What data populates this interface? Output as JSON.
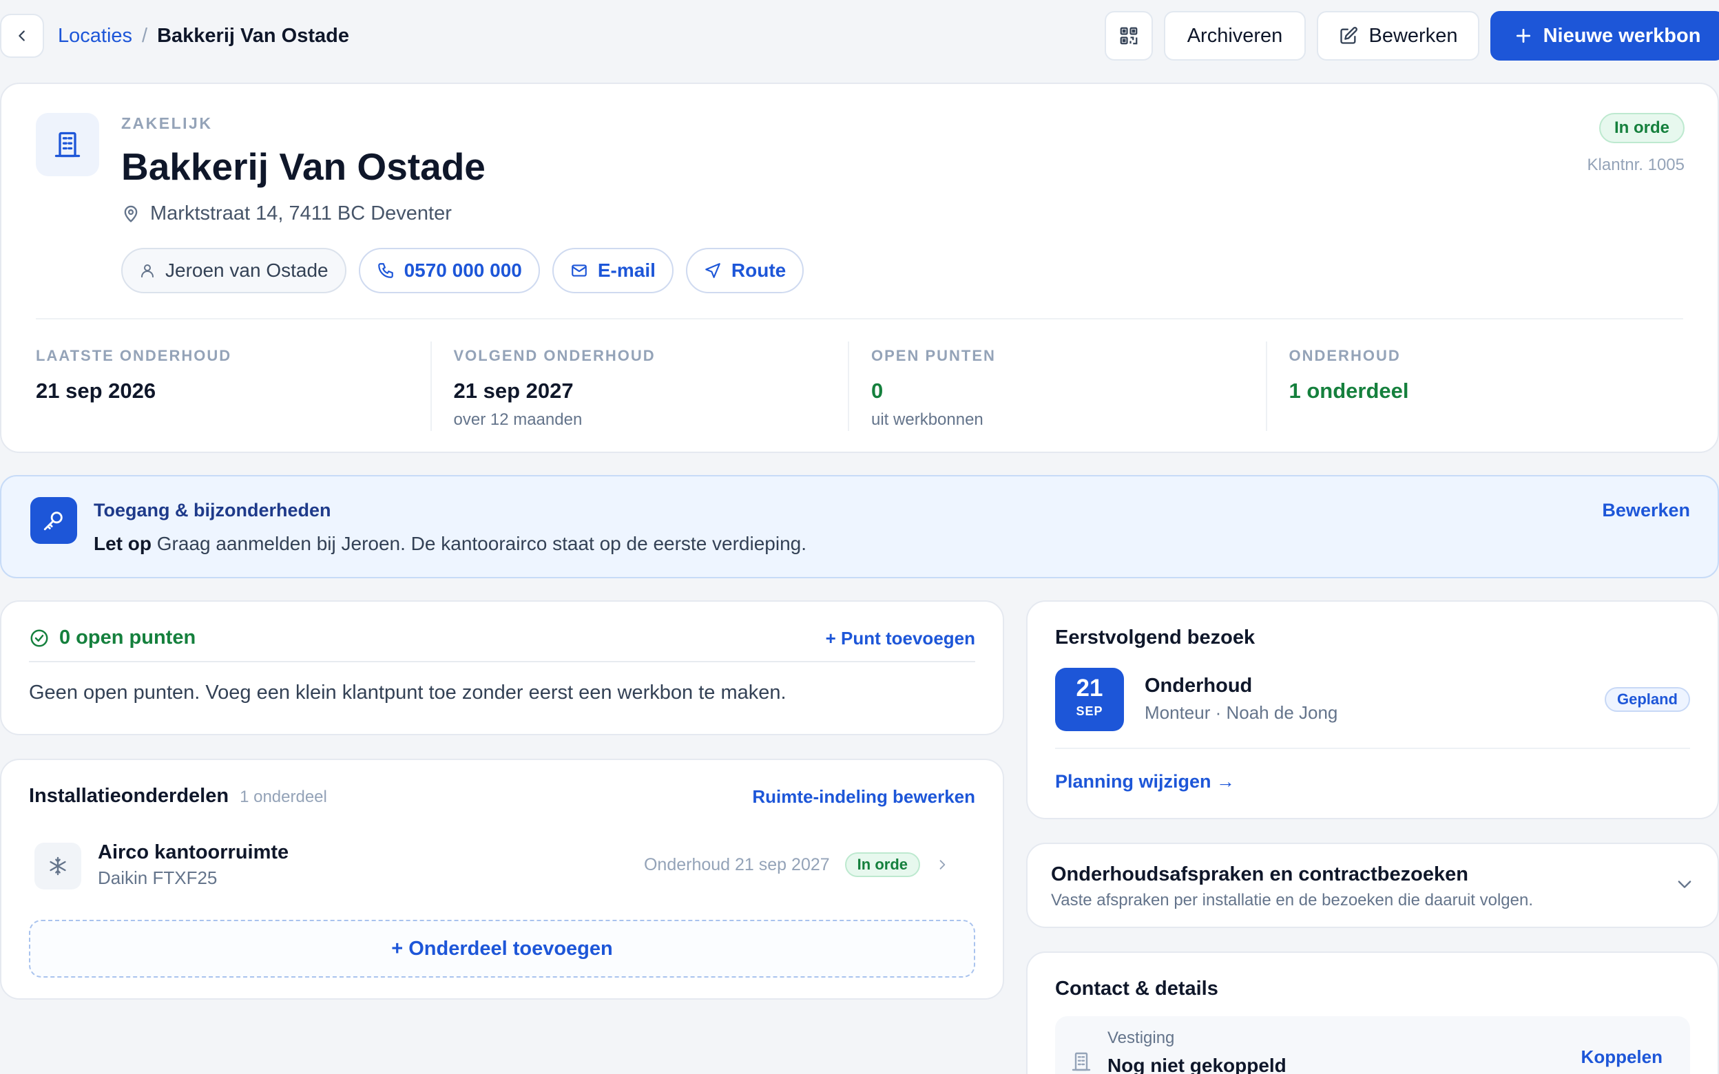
{
  "breadcrumb": {
    "parent": "Locaties",
    "separator": "/",
    "current": "Bakkerij Van Ostade"
  },
  "toolbar": {
    "archive_label": "Archiveren",
    "edit_label": "Bewerken",
    "new_label": "Nieuwe werkbon",
    "icons": {
      "back": "chevron-left-icon",
      "qr": "qr-code-icon",
      "edit": "pencil-square-icon",
      "new": "plus-icon"
    }
  },
  "location": {
    "type": "ZAKELIJK",
    "name": "Bakkerij Van Ostade",
    "address": "Marktstraat 14, 7411 BC Deventer",
    "status": "In orde",
    "customer_number": "Klantnr. 1005",
    "contacts": {
      "person": "Jeroen van Ostade",
      "phone": "0570 000 000",
      "email": "E-mail",
      "route": "Route"
    }
  },
  "stats": [
    {
      "label": "LAATSTE ONDERHOUD",
      "value": "21 sep 2026",
      "sub": ""
    },
    {
      "label": "VOLGEND ONDERHOUD",
      "value": "21 sep 2027",
      "sub": "over 12 maanden"
    },
    {
      "label": "OPEN PUNTEN",
      "value": "0",
      "sub": "uit werkbonnen"
    },
    {
      "label": "ONDERHOUD",
      "value": "1 onderdeel",
      "sub": ""
    }
  ],
  "access": {
    "title": "Toegang & bijzonderheden",
    "prefix": "Let op",
    "text": "Graag aanmelden bij Jeroen. De kantoorairco staat op de eerste verdieping.",
    "edit_label": "Bewerken"
  },
  "open_points": {
    "title": "0 open punten",
    "add_label": "+ Punt toevoegen",
    "empty_text": "Geen open punten. Voeg een klein klantpunt toe zonder eerst een werkbon te maken."
  },
  "installation": {
    "title": "Installatieonderdelen",
    "count": "1 onderdeel",
    "edit_label": "Ruimte-indeling bewerken",
    "parts": [
      {
        "name": "Airco kantoorruimte",
        "model": "Daikin FTXF25",
        "next": "Onderhoud 21 sep 2027",
        "status": "In orde"
      }
    ],
    "add_label": "+ Onderdeel toevoegen"
  },
  "next_visit": {
    "title": "Eerstvolgend bezoek",
    "day": "21",
    "month": "SEP",
    "kind": "Onderhoud",
    "technician": "Monteur · Noah de Jong",
    "status": "Gepland",
    "link_label": "Planning wijzigen →"
  },
  "contracts": {
    "title": "Onderhoudsafspraken en contractbezoeken",
    "subtitle": "Vaste afspraken per installatie en de bezoeken die daaruit volgen."
  },
  "contact_details": {
    "title": "Contact & details",
    "branch_label": "Vestiging",
    "branch_value": "Nog niet gekoppeld",
    "link_label": "Koppelen"
  },
  "colors": {
    "accent": "#1d56d8",
    "success": "#15803d",
    "muted": "#94a3b8",
    "background": "#f3f5f8"
  }
}
